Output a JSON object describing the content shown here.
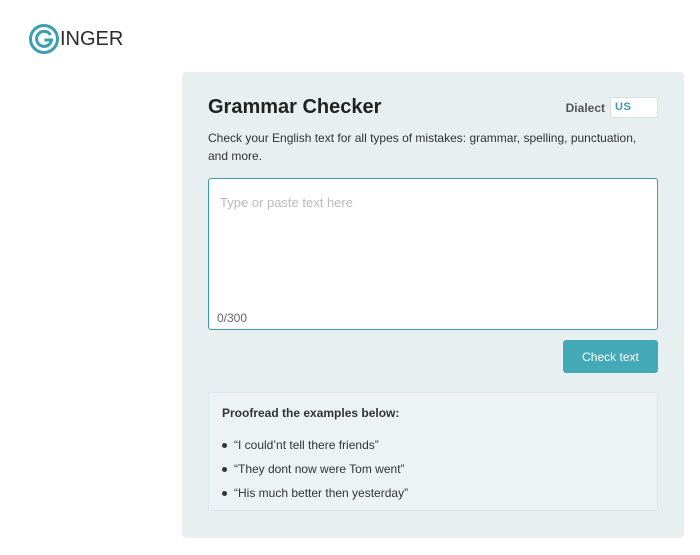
{
  "brand": {
    "logo_text": "INGER",
    "logo_mark": "G",
    "accent": "#3d9aa8"
  },
  "checker": {
    "title": "Grammar Checker",
    "dialect_label": "Dialect",
    "dialect_value": "US",
    "description": "Check your English text for all types of mistakes: grammar, spelling, punctuation, and more.",
    "input_placeholder": "Type or paste text here",
    "char_count": "0/300",
    "check_button": "Check text"
  },
  "examples": {
    "title": "Proofread the examples below:",
    "items": [
      "“I could’nt tell there friends”",
      "“They dont now were Tom went”",
      "“His much better then yesterday”"
    ]
  }
}
